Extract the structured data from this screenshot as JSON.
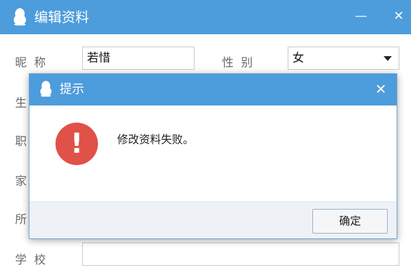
{
  "background_window": {
    "title": "编辑资料",
    "icon": "qq-penguin-icon",
    "minimize_glyph": "—",
    "close_glyph": "✕",
    "form": {
      "nickname": {
        "label": "昵  称",
        "value": "若惜"
      },
      "gender": {
        "label": "性  别",
        "value": "女"
      },
      "partial_labels": [
        "生",
        "职",
        "家",
        "所"
      ],
      "school": {
        "label": "学  校",
        "value": ""
      }
    }
  },
  "dialog": {
    "title": "提示",
    "icon": "qq-penguin-icon",
    "close_glyph": "✕",
    "error_icon": "error-exclamation-icon",
    "error_glyph": "!",
    "error_color": "#e05148",
    "message": "修改资料失败。",
    "ok_label": "确定"
  },
  "colors": {
    "titlebar": "#4d9cdb",
    "footer": "#eef1f5"
  }
}
